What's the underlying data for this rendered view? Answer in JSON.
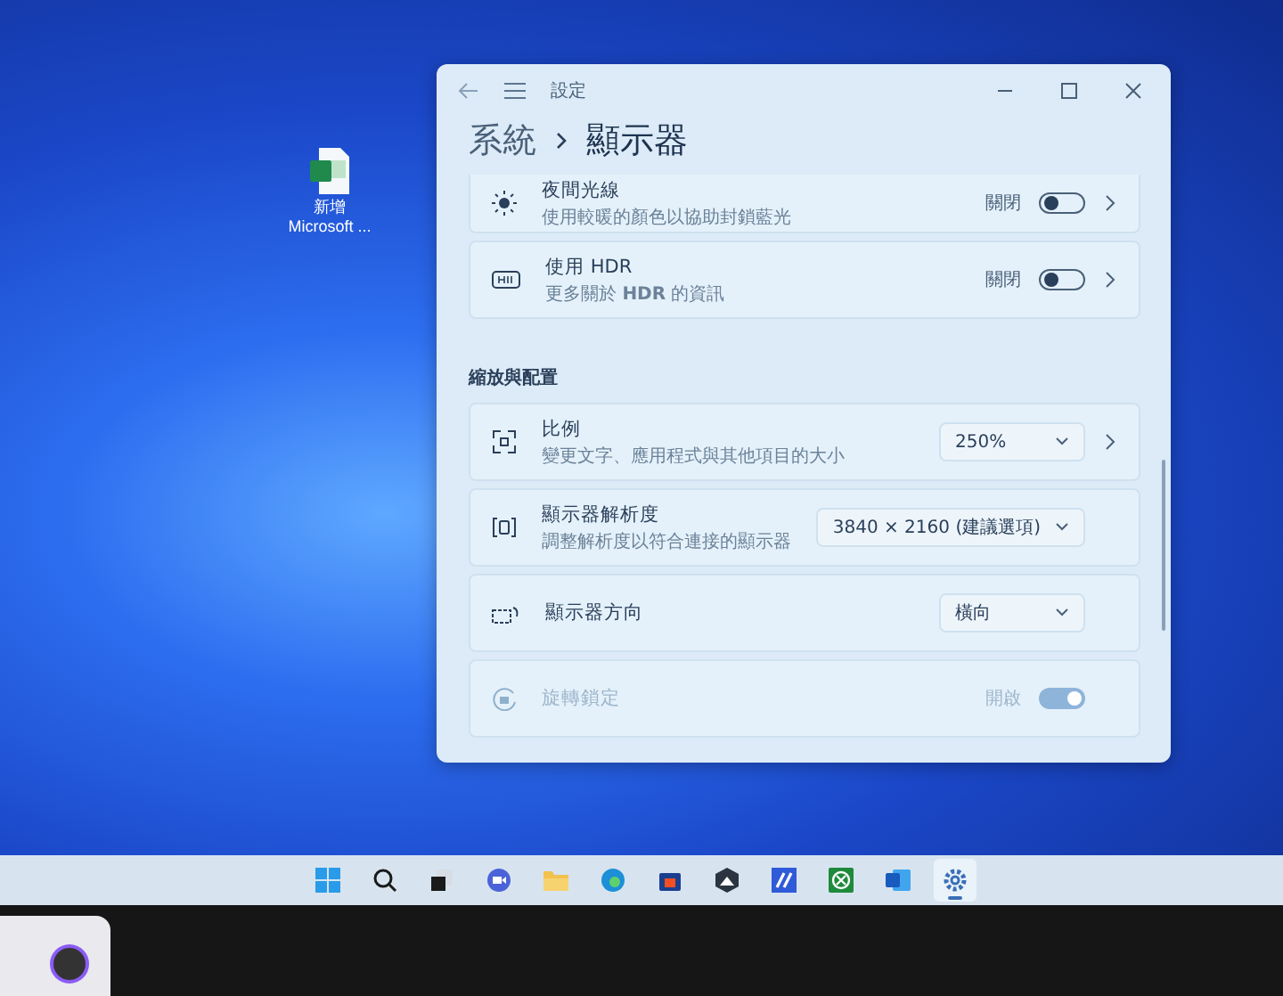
{
  "desktop_icon": {
    "label_lines": [
      "新增",
      "Microsoft ..."
    ]
  },
  "window": {
    "title": "設定",
    "breadcrumb": [
      "系統",
      "顯示器"
    ]
  },
  "groups": [
    {
      "rows": [
        {
          "kind": "toggle",
          "title": "夜間光線",
          "subtitle": "使用較暖的顏色以協助封鎖藍光",
          "state_text": "關閉",
          "on": false,
          "disabled": false,
          "chevron": true
        },
        {
          "kind": "toggle",
          "title": "使用 HDR",
          "subtitle": "更多關於 **HDR** 的資訊",
          "state_text": "關閉",
          "on": false,
          "disabled": false,
          "chevron": true
        }
      ]
    },
    {
      "heading": "縮放與配置",
      "rows": [
        {
          "kind": "dropdown",
          "title": "比例",
          "subtitle": "變更文字、應用程式與其他項目的大小",
          "value": "250%",
          "disabled": false,
          "chevron": true
        },
        {
          "kind": "dropdown",
          "title": "顯示器解析度",
          "subtitle": "調整解析度以符合連接的顯示器",
          "value": "3840 × 2160 (建議選項)",
          "disabled": false,
          "chevron": false
        },
        {
          "kind": "dropdown",
          "title": "顯示器方向",
          "value": "橫向",
          "disabled": false,
          "chevron": false
        },
        {
          "kind": "toggle",
          "title": "旋轉鎖定",
          "state_text": "開啟",
          "on": true,
          "disabled": true,
          "chevron": false
        }
      ]
    }
  ],
  "taskbar": {
    "apps": [
      {
        "kind": "start",
        "selected": false
      },
      {
        "kind": "search",
        "selected": false
      },
      {
        "kind": "taskview",
        "selected": false
      },
      {
        "kind": "chat",
        "selected": false
      },
      {
        "kind": "explorer",
        "selected": false
      },
      {
        "kind": "edge",
        "selected": false
      },
      {
        "kind": "store",
        "selected": false
      },
      {
        "kind": "mountain",
        "selected": false
      },
      {
        "kind": "tile",
        "selected": false
      },
      {
        "kind": "xbox",
        "selected": false
      },
      {
        "kind": "word",
        "selected": false
      },
      {
        "kind": "settings",
        "selected": true
      }
    ]
  }
}
